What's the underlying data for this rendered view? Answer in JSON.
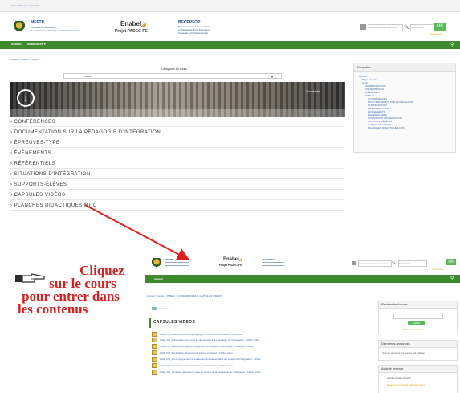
{
  "top": {
    "topbar_text": "Vous n'êtes pas connecté",
    "org1": {
      "name": "MEFTP",
      "sub1": "Ministère de l'Éducation",
      "sub2": "de la Formation Technique et Professionnelle"
    },
    "enabel": {
      "name": "Enabel",
      "project": "Projet PADEC-FE"
    },
    "org3": {
      "name": "BECEPFGP",
      "sub1": "Bureau d'Études des Curricula",
      "sub2": "et Pédagogie de la Formation",
      "sub3": "Générale et Professionnelle"
    },
    "search_placeholder": "Rechercher dans les cours",
    "search_label": "Rechercher",
    "search_button": "OK",
    "login_link": "Connexion",
    "nav": [
      "Accueil",
      "Ressources ▾"
    ],
    "breadcrumb": "Accueil > Cours > PUBLIC",
    "category_label": "Catégories de cours:",
    "category_value": "PUBLIC",
    "banner_text": "Tout réduire",
    "categories": [
      "CONFÉRENCES",
      "DOCUMENTATION SUR LA PÉDAGOGIE D'INTÉGRATION",
      "ÉPREUVES-TYPE",
      "ÉVÉNEMENTS",
      "RÉFÉRENTIELS",
      "SITUATIONS D'INTÉGRATION",
      "SUPPORTS-ÉLÈVES",
      "CAPSULES VIDÉOS",
      "PLANCHES DIDACTIQUES NTIC"
    ],
    "navigation": {
      "title": "Navigation",
      "items": [
        "Accueil",
        "Pages du site",
        "Cours",
        "ADMINISTRATION",
        "CONFÉRENCES",
        "EVÉNEMENT",
        "PUBLIC",
        "CONFÉRENCES",
        "DOCUMENTATION SUR LA PÉDAGOGIE",
        "D'INTÉGRATION",
        "ÉPREUVES-TYPE",
        "ÉVÉNEMENTS",
        "RÉFÉRENTIELS",
        "SITUATIONS D'INTÉGRATION",
        "SUPPORTS-ÉLÈVES",
        "CAPSULES VIDÉOS",
        "PLANCHES DIDACTIQUES NTIC"
      ]
    }
  },
  "bottom": {
    "org1": {
      "name": "MEFTP"
    },
    "enabel": {
      "name": "Enabel",
      "project": "Projet PADEC-FE"
    },
    "org3": {
      "name": "BECEPFGP"
    },
    "search_placeholder": "Rechercher dans les cours",
    "search_label": "Rechercher",
    "search_button": "OK",
    "login_link": "Connexion",
    "nav": [
      "Accueil"
    ],
    "breadcrumb": "Accueil > Cours > PUBLIC > CONFÉRENCES > CAPSULES VIDÉOS",
    "announcements": "Annonces",
    "section_title": "CAPSULES VIDEOS",
    "files": [
      "CHE_VID_CAPSULES Vidéo pédagogie - Fichier vidéo capsule de formation",
      "CHE_VID_Présentation du projet et introduction à la pédagogie de l'intégration - Fichier vidéo",
      "CHE_VID_Capsule de l'apprentissage par les situations d'intégration en classe - Fichier",
      "CHE_VID_Exploitation des supports élèves en classe - Fichier vidéo",
      "CHE_VID_Accompagnement et évaluation des élèves dans les situations d'intégration - Fichier",
      "CHE_VID_Conclusion et perspectives de la formation - Fichier vidéo",
      "CHE_VID_Synthèse générale et mise en œuvre de la pédagogie de l'intégration - Fichier vidéo"
    ],
    "blocks": {
      "search_forums": {
        "title": "Recherche forums",
        "button": "Valider",
        "link": "Recherche avancée"
      },
      "latest_news": {
        "title": "Dernières annonces",
        "text": "Aucune annonce n'a encore été publiée"
      },
      "recent_activity": {
        "title": "Activité récente",
        "text": "Activité depuis le lundi",
        "link": "Rapport complet de l'activité récente"
      }
    }
  },
  "hint": {
    "line1": "Cliquez",
    "line2": "sur le cours",
    "line3": "pour entrer dans",
    "line4": "les contenus"
  },
  "colors": {
    "nav_green": "#3e8a2c",
    "button_green": "#5cb85c",
    "annotation_red": "#d42020"
  }
}
